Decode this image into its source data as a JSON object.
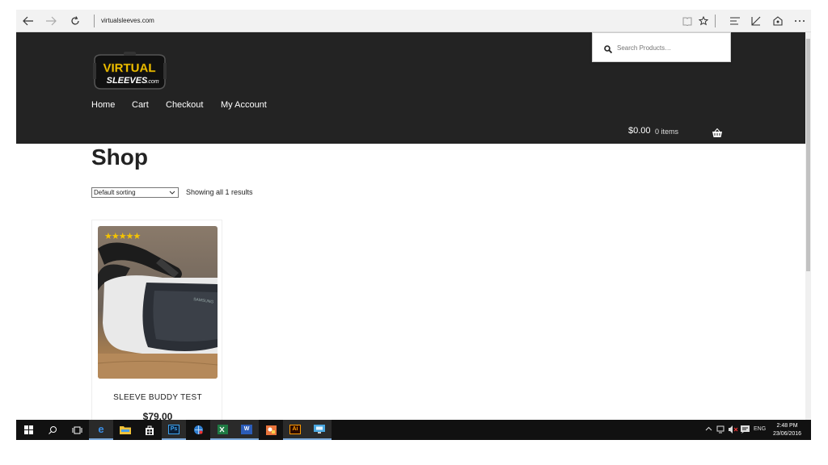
{
  "browser": {
    "address": "virtualsleeves.com",
    "icons": [
      "back-arrow-icon",
      "forward-arrow-icon",
      "refresh-icon",
      "reading-view-icon",
      "favorite-star-icon",
      "hub-icon",
      "web-note-icon",
      "share-icon",
      "more-icon"
    ]
  },
  "site": {
    "logo_top": "VIRTUAL",
    "logo_bottom": "SLEEVES",
    "logo_suffix": ".com",
    "nav": [
      "Home",
      "Cart",
      "Checkout",
      "My Account"
    ],
    "cart_total": "$0.00",
    "cart_items": "0 items",
    "search_placeholder": "Search Products…"
  },
  "shop": {
    "title": "Shop",
    "sort_value": "Default sorting",
    "result_count": "Showing all 1 results",
    "product": {
      "name": "SLEEVE BUDDY TEST",
      "price": "$79.00",
      "rating": 5,
      "stars": "★★★★★",
      "headset_brand": "SAMSUNG"
    }
  },
  "taskbar": {
    "apps": [
      "Ps",
      "W",
      "Ai"
    ],
    "lang": "ENG",
    "time": "2:48 PM",
    "date": "23/06/2016"
  },
  "colors": {
    "header_bg": "#232323",
    "logo_yellow": "#f5c400",
    "taskbar_bg": "#111111"
  }
}
